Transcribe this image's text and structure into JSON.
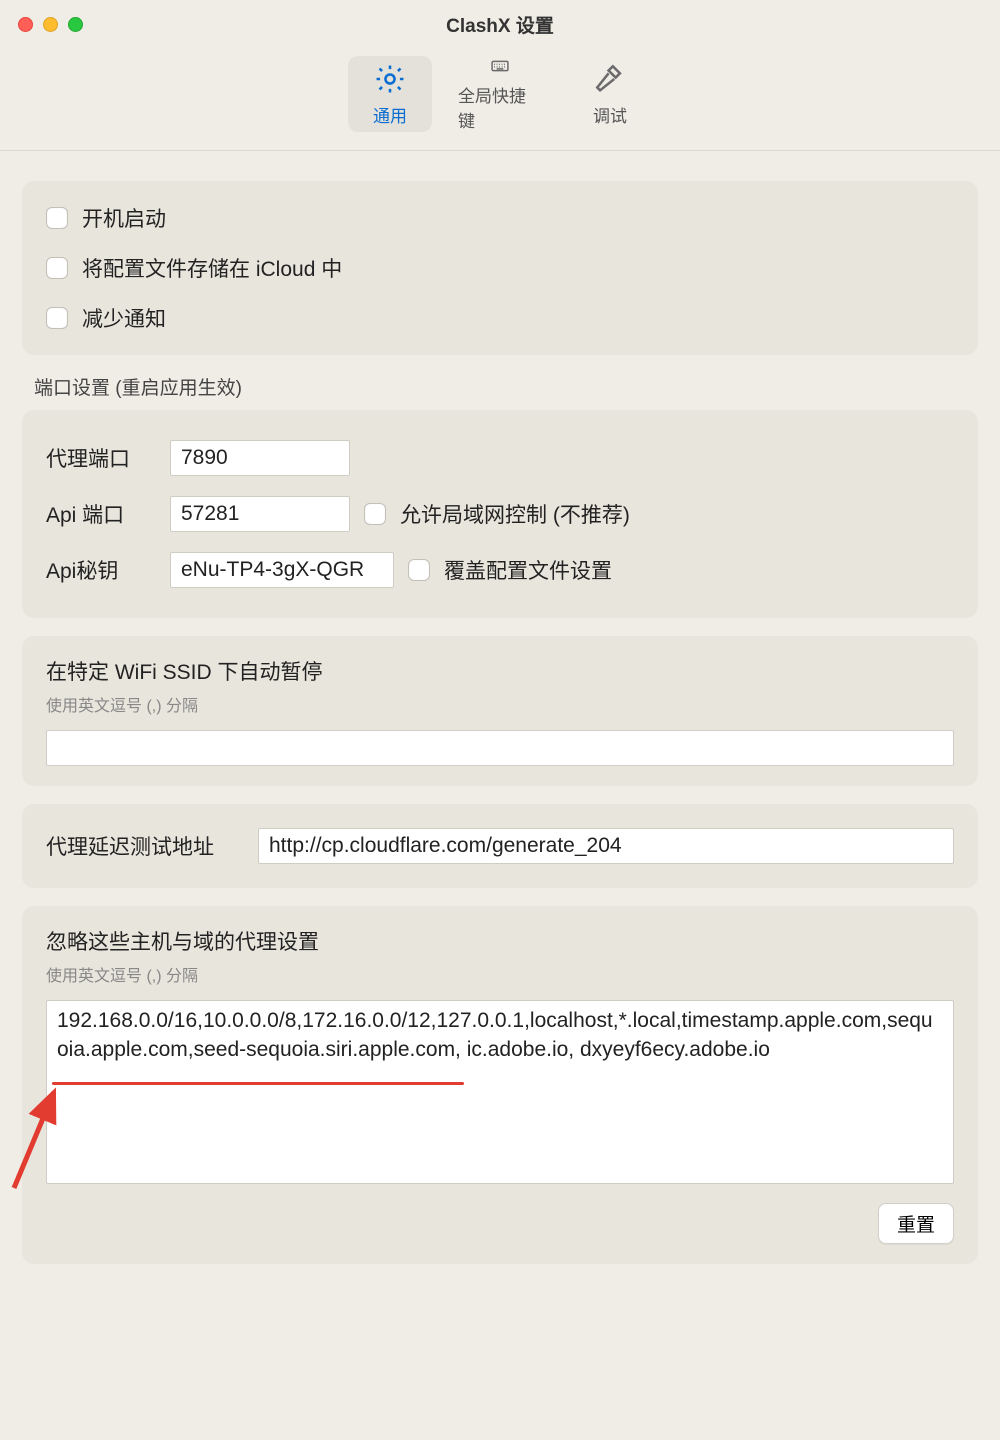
{
  "window": {
    "title": "ClashX 设置"
  },
  "tabs": {
    "general": "通用",
    "hotkey": "全局快捷键",
    "debug": "调试"
  },
  "checks": {
    "launchAtLogin": "开机启动",
    "storeIcloud": "将配置文件存储在 iCloud 中",
    "reduceNotif": "减少通知"
  },
  "portSection": {
    "header": "端口设置 (重启应用生效)",
    "proxyPortLabel": "代理端口",
    "proxyPortValue": "7890",
    "apiPortLabel": "Api 端口",
    "apiPortValue": "57281",
    "allowLan": "允许局域网控制 (不推荐)",
    "apiSecretLabel": "Api秘钥",
    "apiSecretValue": "eNu-TP4-3gX-QGR",
    "overrideConfig": "覆盖配置文件设置"
  },
  "wifi": {
    "title": "在特定 WiFi SSID 下自动暂停",
    "hint": "使用英文逗号 (,) 分隔",
    "value": ""
  },
  "latency": {
    "label": "代理延迟测试地址",
    "value": "http://cp.cloudflare.com/generate_204"
  },
  "ignore": {
    "title": "忽略这些主机与域的代理设置",
    "hint": "使用英文逗号 (,) 分隔",
    "value": "192.168.0.0/16,10.0.0.0/8,172.16.0.0/12,127.0.0.1,localhost,*.local,timestamp.apple.com,sequoia.apple.com,seed-sequoia.siri.apple.com, ic.adobe.io, dxyeyf6ecy.adobe.io",
    "resetLabel": "重置"
  }
}
